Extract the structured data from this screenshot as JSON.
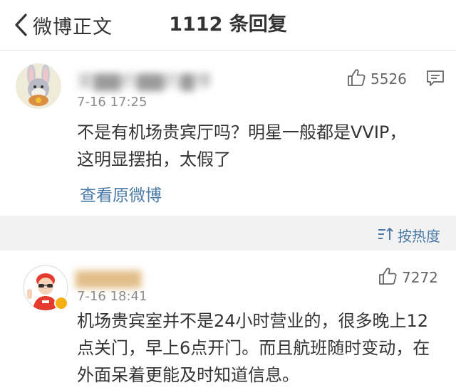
{
  "nav": {
    "back_label": "微博正文",
    "title": "1112 条回复"
  },
  "main_comment": {
    "username": "爱▇▇的▇▇的▇博",
    "time": "7-16 17:25",
    "likes": "5526",
    "text_line1": "不是有机场贵宾厅吗？明星一般都是VVIP，",
    "text_line2": "这明显摆拍，太假了",
    "view_original": "查看原微博"
  },
  "sort": {
    "label": "按热度"
  },
  "reply": {
    "username": "▇▇▇▇▇",
    "time": "7-16 18:41",
    "likes": "7272",
    "text_line1": "机场贵宾室并不是24小时营业的，很多晚上12",
    "text_line2": "点关门，早上6点开门。而且航班随时变动，在",
    "text_line3": "外面呆着更能及时知道信息。"
  },
  "colors": {
    "link": "#4a7aa8",
    "verified": "#f6b014"
  }
}
